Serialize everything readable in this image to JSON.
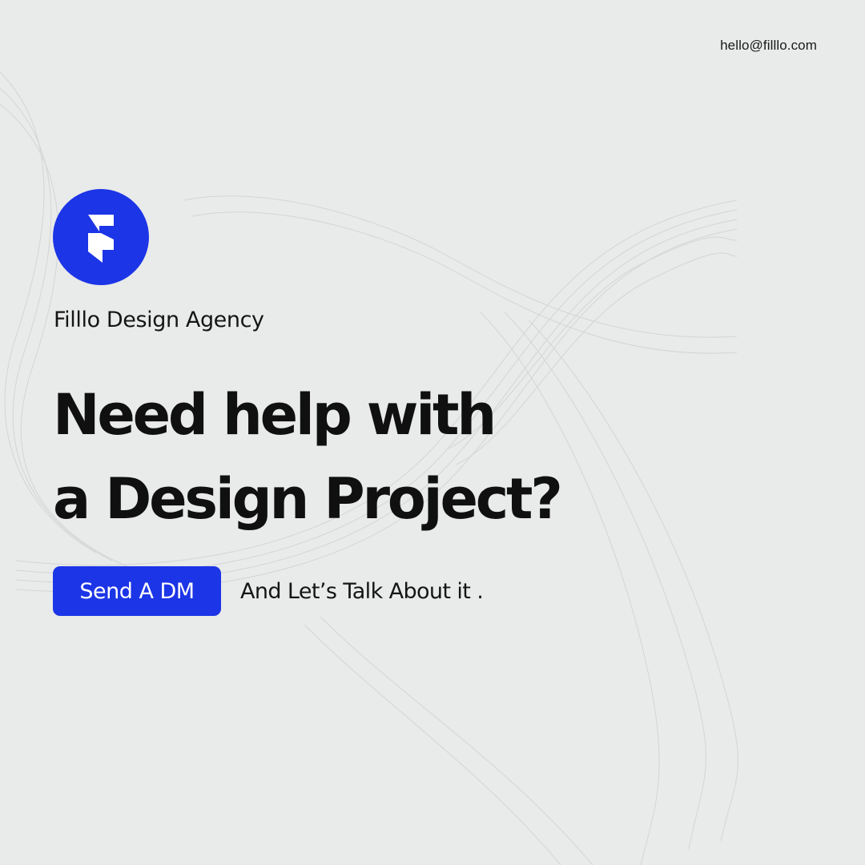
{
  "contact": {
    "email": "hello@filllo.com"
  },
  "brand": {
    "name": "Filllo Design Agency",
    "logo_icon": "filllo-logo-icon",
    "accent_color": "#1c35e6",
    "background_color": "#e9eaea"
  },
  "headline": {
    "line1": "Need help with",
    "line2": "a Design Project?"
  },
  "cta": {
    "button_label": "Send A DM",
    "text": "And Let’s Talk About it ."
  }
}
